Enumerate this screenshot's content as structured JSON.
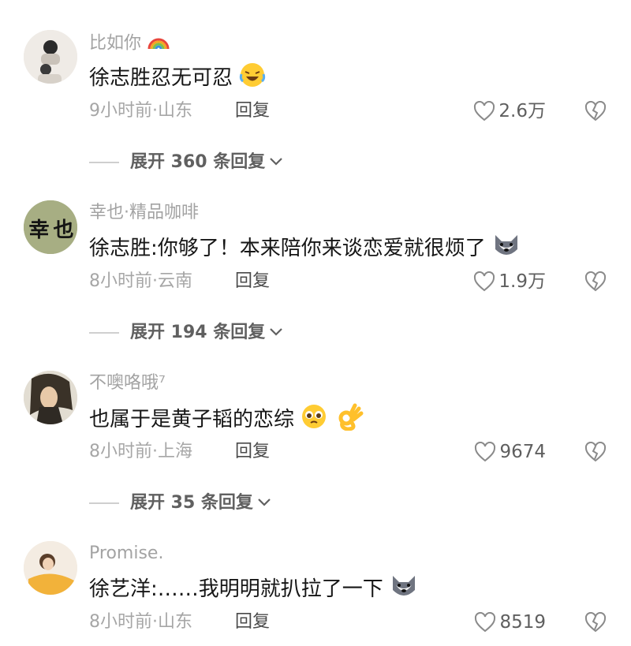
{
  "comments": [
    {
      "username": "比如你",
      "text": "徐志胜忍无可忍",
      "time_location": "9小时前·山东",
      "reply_label": "回复",
      "likes": "2.6万",
      "expand_label": "展开 360 条回复"
    },
    {
      "username": "幸也·精品咖啡",
      "avatar_text": "幸 也",
      "text": "徐志胜:你够了！本来陪你来谈恋爱就很烦了",
      "time_location": "8小时前·云南",
      "reply_label": "回复",
      "likes": "1.9万",
      "expand_label": "展开 194 条回复"
    },
    {
      "username": "不噢咯哦⁷",
      "text": "也属于是黄子韬的恋综",
      "time_location": "8小时前·上海",
      "reply_label": "回复",
      "likes": "9674",
      "expand_label": "展开 35 条回复"
    },
    {
      "username": "Promise.",
      "text": "徐艺洋:……我明明就扒拉了一下",
      "time_location": "8小时前·山东",
      "reply_label": "回复",
      "likes": "8519"
    }
  ],
  "icons": {
    "like": "heart-outline-icon",
    "dislike": "broken-heart-icon",
    "expand": "chevron-down-icon"
  },
  "colors": {
    "username": "#a3a3a3",
    "text": "#161616",
    "meta": "#a6a6a6",
    "reply": "#4a4a4a"
  }
}
